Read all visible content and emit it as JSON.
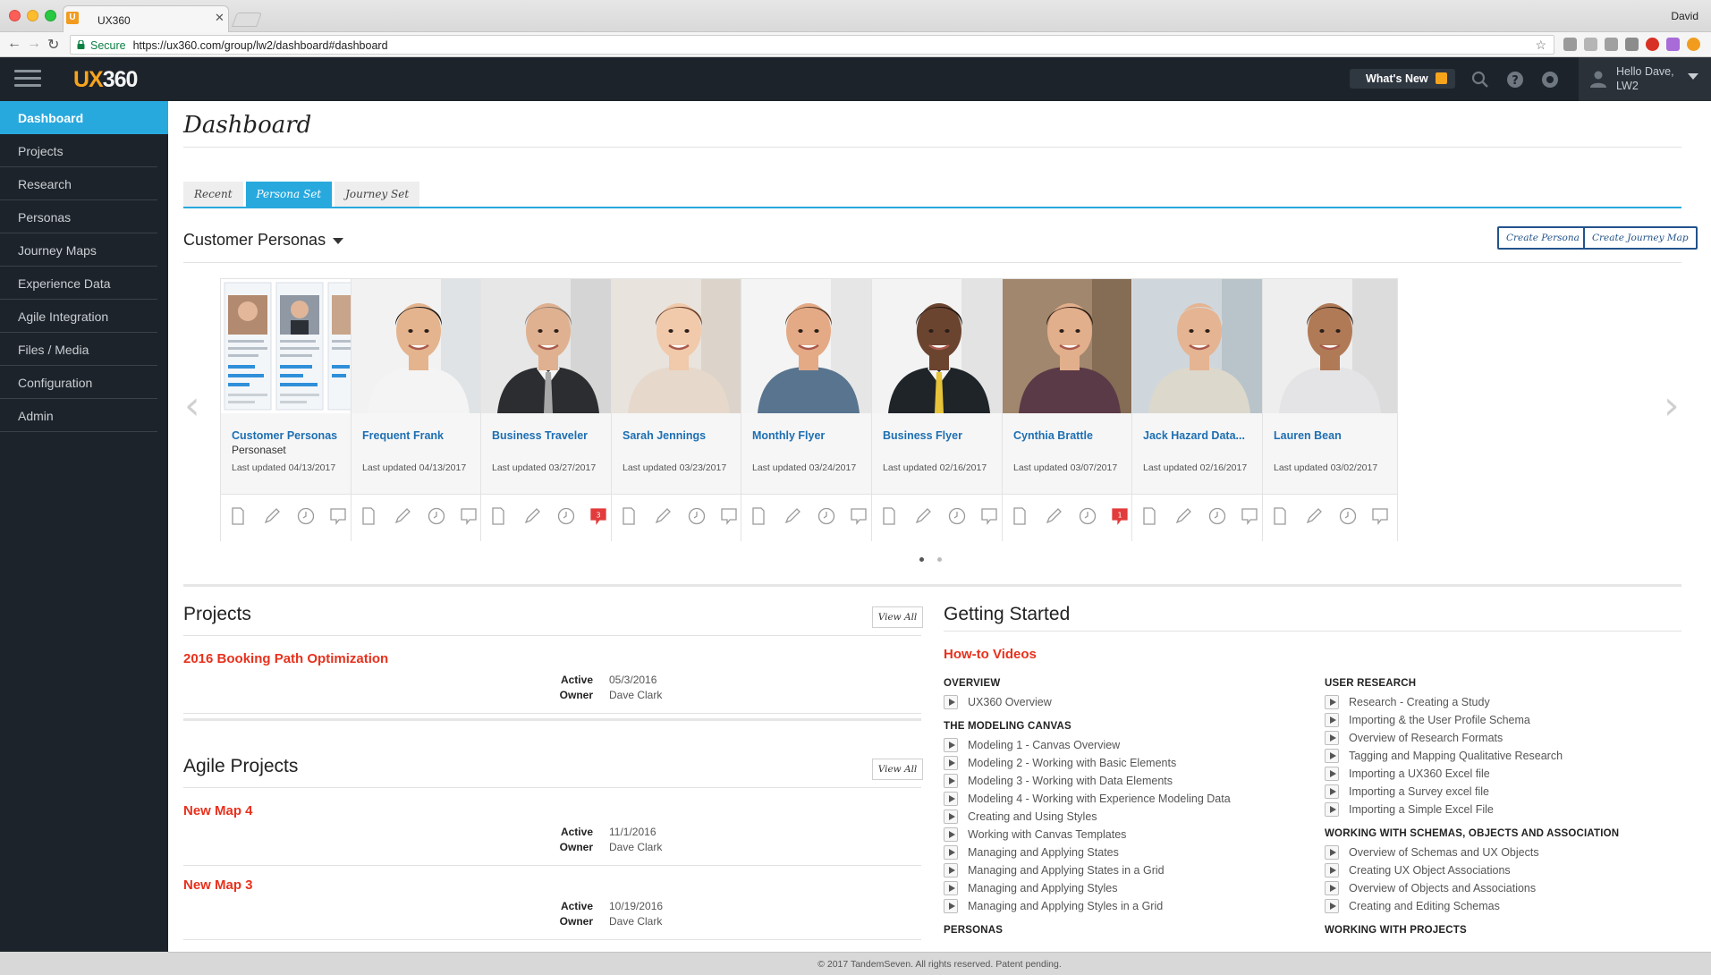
{
  "browser": {
    "tab_title": "UX360",
    "tab_favicon": "U",
    "profile_name": "David",
    "secure_label": "Secure",
    "url": "https://ux360.com/group/lw2/dashboard#dashboard"
  },
  "header": {
    "logo_ux": "UX",
    "logo_num": "360",
    "whats_new": "What's New",
    "user_greeting": "Hello Dave, LW2"
  },
  "sidebar": {
    "items": [
      {
        "label": "Dashboard",
        "active": true
      },
      {
        "label": "Projects"
      },
      {
        "label": "Research"
      },
      {
        "label": "Personas"
      },
      {
        "label": "Journey Maps"
      },
      {
        "label": "Experience Data"
      },
      {
        "label": "Agile Integration"
      },
      {
        "label": "Files / Media"
      },
      {
        "label": "Configuration"
      },
      {
        "label": "Admin"
      }
    ]
  },
  "page": {
    "title": "Dashboard",
    "tabs": [
      {
        "label": "Recent"
      },
      {
        "label": "Persona Set",
        "active": true
      },
      {
        "label": "Journey Set"
      }
    ]
  },
  "personas": {
    "section_title": "Customer Personas",
    "create_persona": "Create Persona",
    "create_journey_map": "Create Journey Map",
    "cards": [
      {
        "name": "Customer Personas",
        "sub": "Personaset",
        "updated": "Last updated 04/13/2017",
        "comments": ""
      },
      {
        "name": "Frequent Frank",
        "sub": "",
        "updated": "Last updated 04/13/2017",
        "comments": ""
      },
      {
        "name": "Business Traveler",
        "sub": "",
        "updated": "Last updated 03/27/2017",
        "comments": "3"
      },
      {
        "name": "Sarah Jennings",
        "sub": "",
        "updated": "Last updated 03/23/2017",
        "comments": ""
      },
      {
        "name": "Monthly Flyer",
        "sub": "",
        "updated": "Last updated 03/24/2017",
        "comments": ""
      },
      {
        "name": "Business Flyer",
        "sub": "",
        "updated": "Last updated 02/16/2017",
        "comments": ""
      },
      {
        "name": "Cynthia Brattle",
        "sub": "",
        "updated": "Last updated 03/07/2017",
        "comments": "1"
      },
      {
        "name": "Jack Hazard Data...",
        "sub": "",
        "updated": "Last updated 02/16/2017",
        "comments": ""
      },
      {
        "name": "Lauren Bean",
        "sub": "",
        "updated": "Last updated 03/02/2017",
        "comments": ""
      }
    ]
  },
  "projects": {
    "title": "Projects",
    "view_all": "View All",
    "items": [
      {
        "name": "2016 Booking Path Optimization",
        "status_label": "Active",
        "status_value": "05/3/2016",
        "owner_label": "Owner",
        "owner_value": "Dave Clark"
      }
    ]
  },
  "agile_projects": {
    "title": "Agile Projects",
    "view_all": "View All",
    "items": [
      {
        "name": "New Map 4",
        "status_label": "Active",
        "status_value": "11/1/2016",
        "owner_label": "Owner",
        "owner_value": "Dave Clark"
      },
      {
        "name": "New Map 3",
        "status_label": "Active",
        "status_value": "10/19/2016",
        "owner_label": "Owner",
        "owner_value": "Dave Clark"
      }
    ]
  },
  "getting_started": {
    "title": "Getting Started",
    "subtitle": "How-to Videos",
    "left_column": [
      {
        "category": "OVERVIEW",
        "videos": [
          "UX360 Overview"
        ]
      },
      {
        "category": "THE MODELING CANVAS",
        "videos": [
          "Modeling 1 - Canvas Overview",
          "Modeling 2 - Working with Basic Elements",
          "Modeling 3 - Working with Data Elements",
          "Modeling 4 - Working with Experience Modeling Data",
          "Creating and Using Styles",
          "Working with Canvas Templates",
          "Managing and Applying States",
          "Managing and Applying States in a Grid",
          "Managing and Applying Styles",
          "Managing and Applying Styles in a Grid"
        ]
      },
      {
        "category": "PERSONAS",
        "videos": []
      }
    ],
    "right_column": [
      {
        "category": "USER RESEARCH",
        "videos": [
          "Research - Creating a Study",
          "Importing & the User Profile Schema",
          "Overview of Research Formats",
          "Tagging and Mapping Qualitative Research",
          "Importing a UX360 Excel file",
          "Importing a Survey excel file",
          "Importing a Simple Excel File"
        ]
      },
      {
        "category": "WORKING WITH SCHEMAS, OBJECTS AND ASSOCIATION",
        "videos": [
          "Overview of Schemas and UX Objects",
          "Creating UX Object Associations",
          "Overview of Objects and Associations",
          "Creating and Editing Schemas"
        ]
      },
      {
        "category": "WORKING WITH PROJECTS",
        "videos": []
      }
    ]
  },
  "footer": {
    "text": "© 2017 TandemSeven. All rights reserved. Patent pending."
  },
  "colors": {
    "accent": "#28a9de",
    "header_bg": "#1d232a",
    "link_red": "#e8311d",
    "link_blue": "#1d6fb3",
    "badge_red": "#e23b3b"
  }
}
